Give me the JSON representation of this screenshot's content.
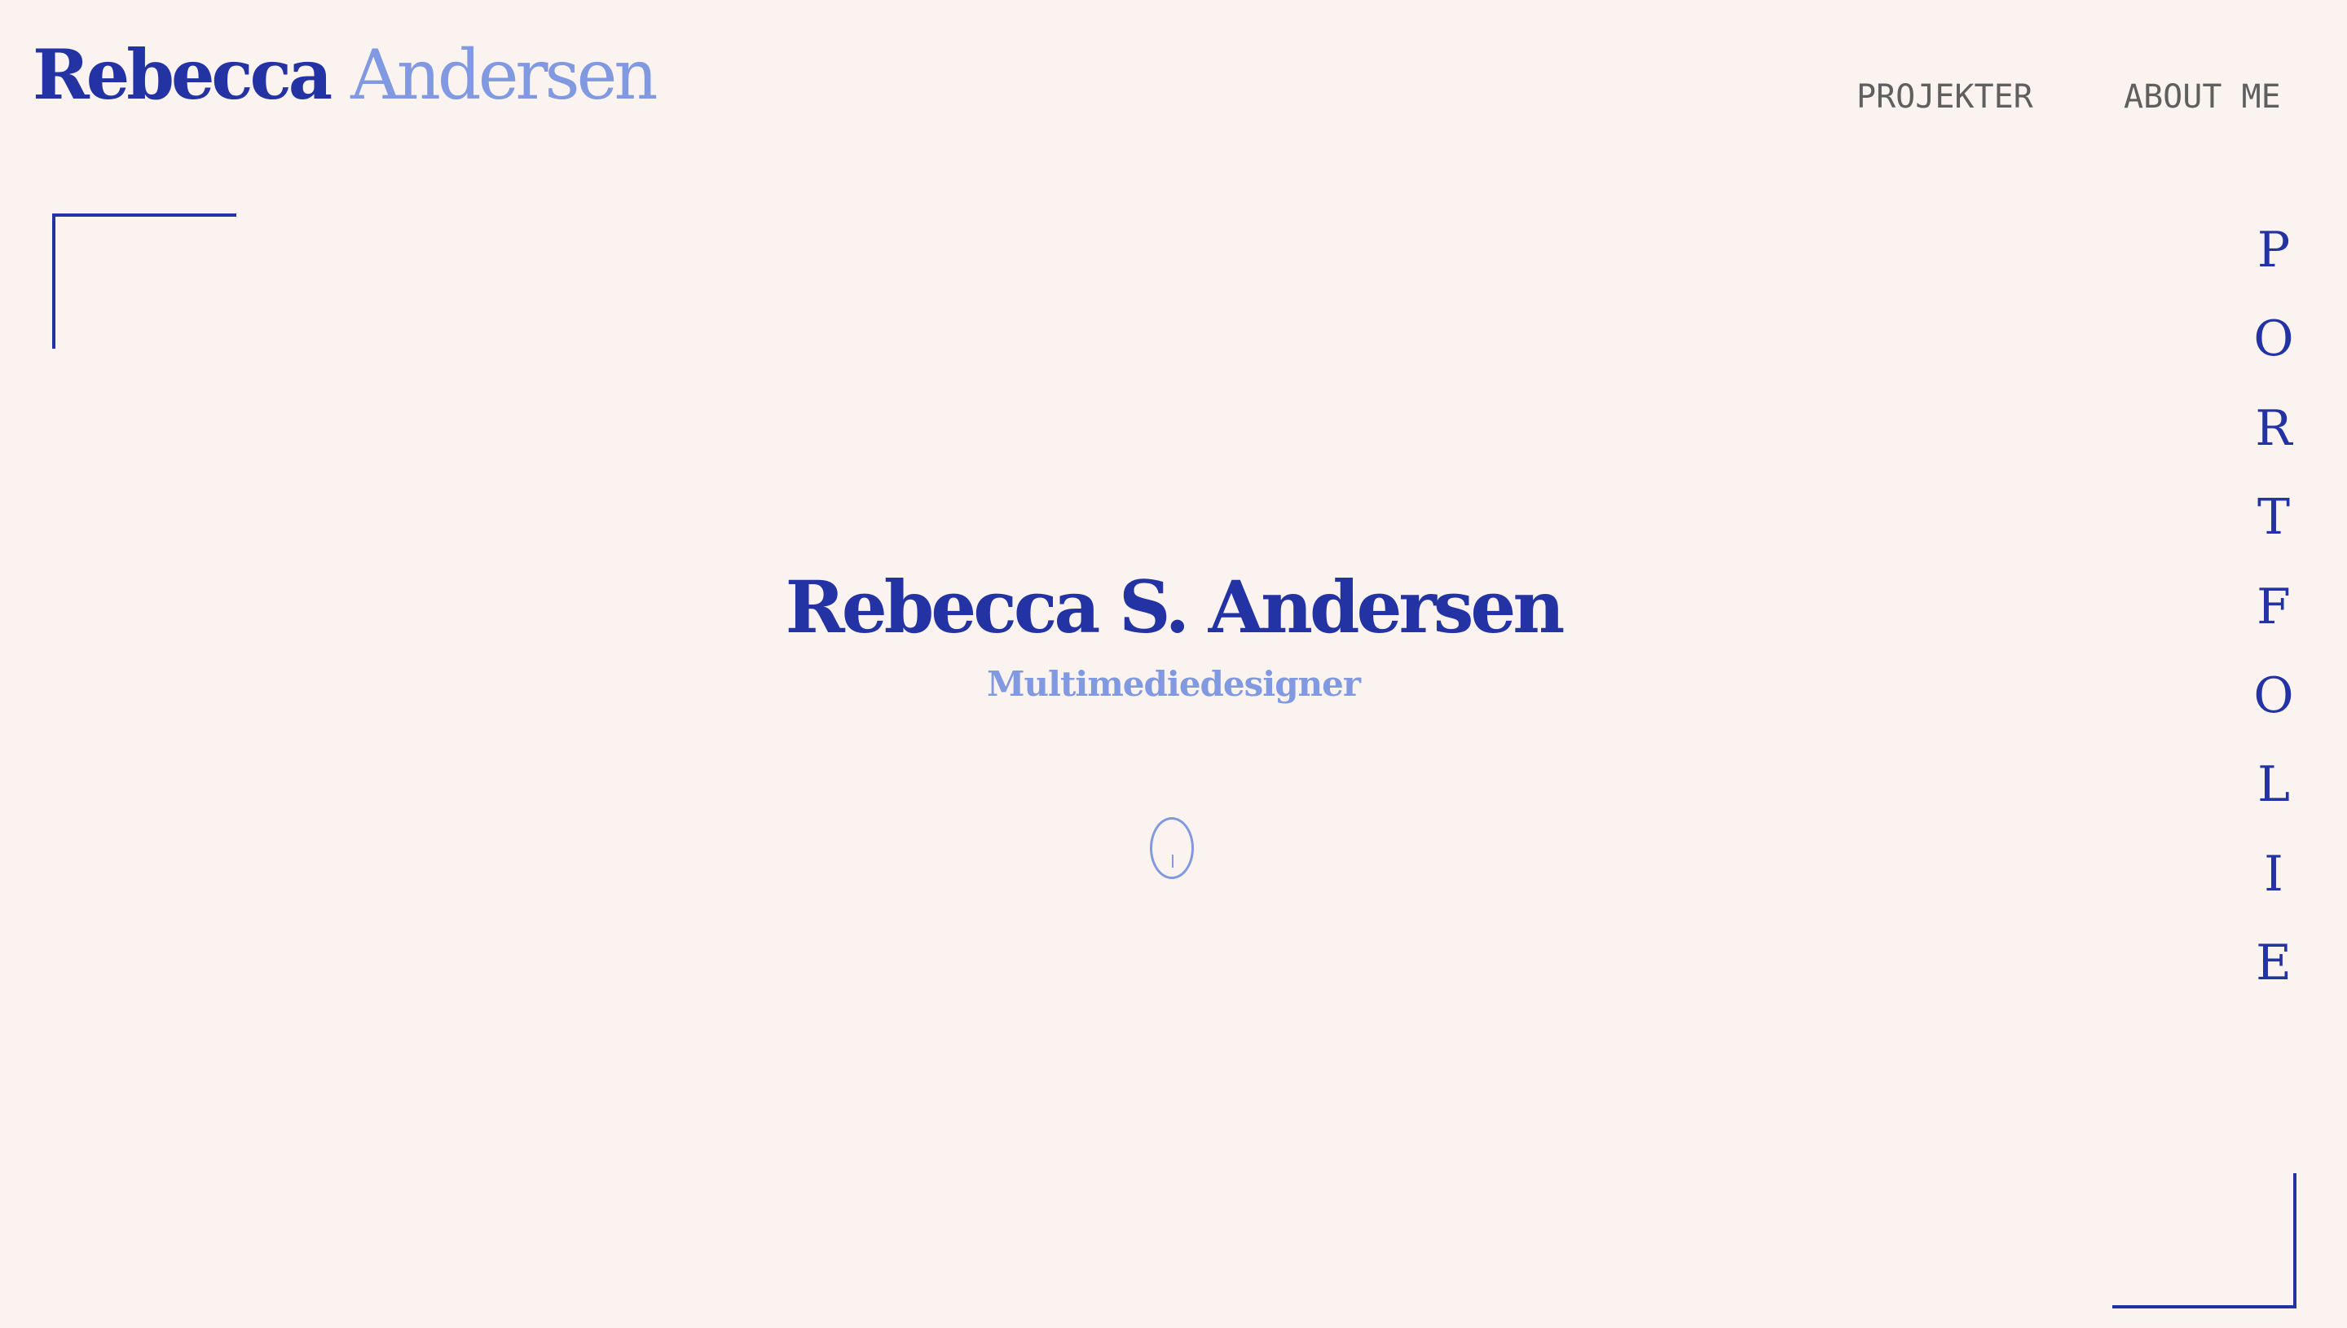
{
  "header": {
    "logo_first": "Rebecca",
    "logo_last": "Andersen"
  },
  "nav": {
    "items": [
      {
        "label": "PROJEKTER"
      },
      {
        "label": "ABOUT ME"
      }
    ]
  },
  "side_word": {
    "letters": [
      "P",
      "O",
      "R",
      "T",
      "F",
      "O",
      "L",
      "I",
      "E"
    ]
  },
  "hero": {
    "title": "Rebecca S. Andersen",
    "subtitle": "Multimediedesigner"
  },
  "colors": {
    "background": "#fbf3f0",
    "primary": "#2433a4",
    "accent": "#8199e0",
    "nav_text": "#5f5f5f"
  },
  "icons": {
    "scroll": "mouse-scroll-icon"
  }
}
